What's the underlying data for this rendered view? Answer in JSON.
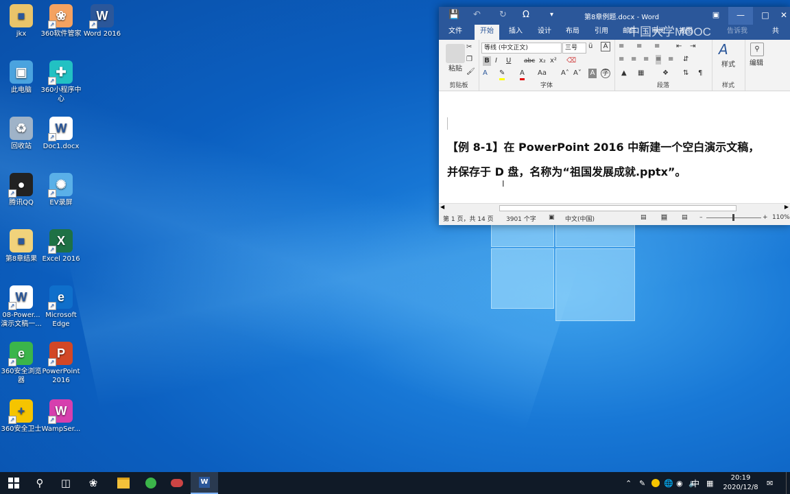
{
  "desktop": {
    "icons": [
      {
        "label": "jkx",
        "icon": "user-folder-icon",
        "color": "#e9c46a"
      },
      {
        "label": "360软件管家",
        "icon": "360-software-manager-icon",
        "color": "#f4a261"
      },
      {
        "label": "Word 2016",
        "icon": "word-icon",
        "color": "#2b579a"
      },
      {
        "label": "此电脑",
        "icon": "this-pc-icon",
        "color": "#4aa3df"
      },
      {
        "label": "360小程序中心",
        "icon": "360-miniapp-center-icon",
        "color": "#22c1c3"
      },
      {
        "label": "回收站",
        "icon": "recycle-bin-icon",
        "color": "#9fb3c8"
      },
      {
        "label": "Doc1.docx",
        "icon": "docx-file-icon",
        "color": "#ffffff"
      },
      {
        "label": "腾讯QQ",
        "icon": "qq-icon",
        "color": "#222222"
      },
      {
        "label": "EV录屏",
        "icon": "ev-recorder-icon",
        "color": "#5ab0e8"
      },
      {
        "label": "第8章结果",
        "icon": "folder-icon",
        "color": "#f1d27b"
      },
      {
        "label": "Excel 2016",
        "icon": "excel-icon",
        "color": "#1e7145"
      },
      {
        "label": "08-Power...演示文稿一...",
        "icon": "word-doc-icon",
        "color": "#ffffff"
      },
      {
        "label": "Microsoft Edge",
        "icon": "edge-icon",
        "color": "#0f6fcb"
      },
      {
        "label": "360安全浏览器",
        "icon": "360-browser-icon",
        "color": "#3bb54a"
      },
      {
        "label": "PowerPoint 2016",
        "icon": "powerpoint-icon",
        "color": "#d24726"
      },
      {
        "label": "360安全卫士",
        "icon": "360-security-icon",
        "color": "#f5c400"
      },
      {
        "label": "WampSer...",
        "icon": "wampserver-icon",
        "color": "#d63fae"
      }
    ]
  },
  "word": {
    "title": "第8章例题.docx - Word",
    "tabs": [
      "文件",
      "开始",
      "插入",
      "设计",
      "布局",
      "引用",
      "邮件",
      "审阅",
      "视图",
      "帮助",
      "告诉我",
      "共享"
    ],
    "watermark": "中国大学MOOC",
    "ribbon": {
      "clipboard": {
        "paste": "粘贴",
        "label": "剪贴板"
      },
      "font": {
        "name": "等线 (中文正文)",
        "size": "三号",
        "label": "字体",
        "bold": "B",
        "italic": "I",
        "underline": "U",
        "strike": "abc",
        "sub": "x₂",
        "sup": "x²"
      },
      "paragraph": {
        "label": "段落"
      },
      "styles": {
        "button": "样式",
        "label": "样式"
      },
      "editing": {
        "button": "编辑"
      }
    },
    "document": {
      "line1": "【例 8-1】在 PowerPoint 2016 中新建一个空白演示文稿，",
      "line2": "并保存于 D 盘，名称为“祖国发展成就.pptx”。"
    },
    "status": {
      "page": "第 1 页，共 14 页",
      "words": "3901 个字",
      "lang": "中文(中国)",
      "zoom": "110%"
    }
  },
  "taskbar": {
    "ime": "中",
    "time": "20:19",
    "date": "2020/12/8"
  }
}
